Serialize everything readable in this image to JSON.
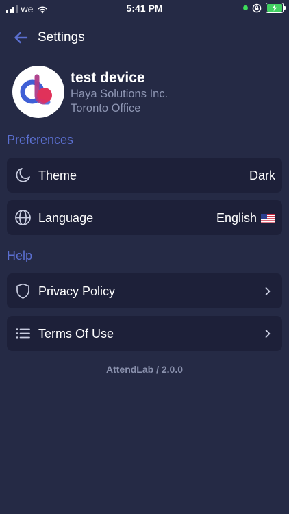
{
  "status_bar": {
    "carrier": "we",
    "time": "5:41 PM"
  },
  "header": {
    "title": "Settings"
  },
  "profile": {
    "device_name": "test device",
    "company": "Haya Solutions Inc.",
    "office": "Toronto Office"
  },
  "preferences": {
    "title": "Preferences",
    "theme": {
      "label": "Theme",
      "value": "Dark",
      "icon": "moon-icon"
    },
    "language": {
      "label": "Language",
      "value": "English",
      "icon": "globe-icon"
    }
  },
  "help": {
    "title": "Help",
    "privacy": {
      "label": "Privacy Policy",
      "icon": "shield-icon"
    },
    "terms": {
      "label": "Terms Of Use",
      "icon": "list-icon"
    }
  },
  "footer": {
    "version": "AttendLab / 2.0.0"
  },
  "colors": {
    "background": "#252a45",
    "card": "#1d2039",
    "accent": "#5b6fd0",
    "muted": "#8e96b3"
  }
}
